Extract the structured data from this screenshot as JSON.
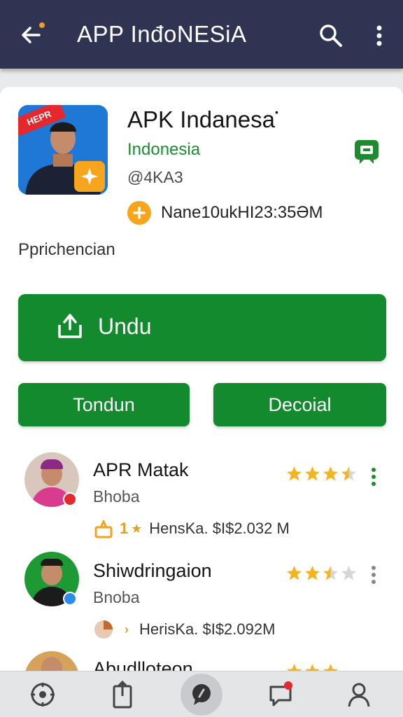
{
  "appbar": {
    "title": "APP InđoNESiA",
    "back_icon": "arrow-left-icon",
    "search_icon": "search-icon",
    "more_icon": "more-vertical-icon"
  },
  "app": {
    "icon_banner": "HEPR",
    "name": "APK Indanesa",
    "name_mark": "•",
    "developer": "Indonesia",
    "handle": "@4KA3",
    "info": "Nane10ukHI23:35ƏM",
    "description_label": "Pprichencian"
  },
  "buttons": {
    "primary": "Undu",
    "left": "Tondun",
    "right": "Decoial"
  },
  "reviews": [
    {
      "name": "APR Matak",
      "sub": "Bhoba",
      "meta_badge": "1",
      "meta_text": "HensKa. $I$2.032 M",
      "rating": 3.5
    },
    {
      "name": "Shiwdringaion",
      "sub": "Bnoba",
      "meta_badge": "",
      "meta_text": "HerisKa. $I$2.092M",
      "rating": 2.5
    },
    {
      "name": "Abudlloteon",
      "sub": "",
      "meta_badge": "",
      "meta_text": "",
      "rating": 3
    }
  ],
  "colors": {
    "appbar": "#2e3452",
    "accent_green": "#128a2d",
    "developer_green": "#1e8b30",
    "star": "#f2b41f",
    "orange": "#f6a51c"
  },
  "bottomnav": {
    "items": [
      "compass-icon",
      "upload-icon",
      "chat-bubble-icon",
      "message-icon",
      "user-icon"
    ]
  }
}
